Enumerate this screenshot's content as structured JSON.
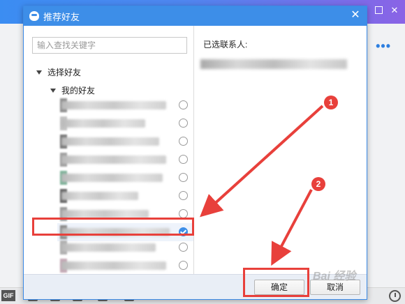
{
  "dialog": {
    "title": "推荐好友",
    "search_placeholder": "输入查找关键字",
    "tree_root": "选择好友",
    "group": "我的好友",
    "selected_contacts_label": "已选联系人:",
    "ok_label": "确定",
    "cancel_label": "取消"
  },
  "contacts": [
    {
      "checked": false
    },
    {
      "checked": false
    },
    {
      "checked": false
    },
    {
      "checked": false
    },
    {
      "checked": false
    },
    {
      "checked": false
    },
    {
      "checked": false
    },
    {
      "checked": true
    },
    {
      "checked": false
    },
    {
      "checked": false
    }
  ],
  "annotations": {
    "badge_1": "1",
    "badge_2": "2"
  },
  "background": {
    "gif_label": "GIF"
  },
  "watermark": "Bai 经验",
  "colors": {
    "accent": "#3d8ee8",
    "annotation_red": "#e8403b"
  }
}
